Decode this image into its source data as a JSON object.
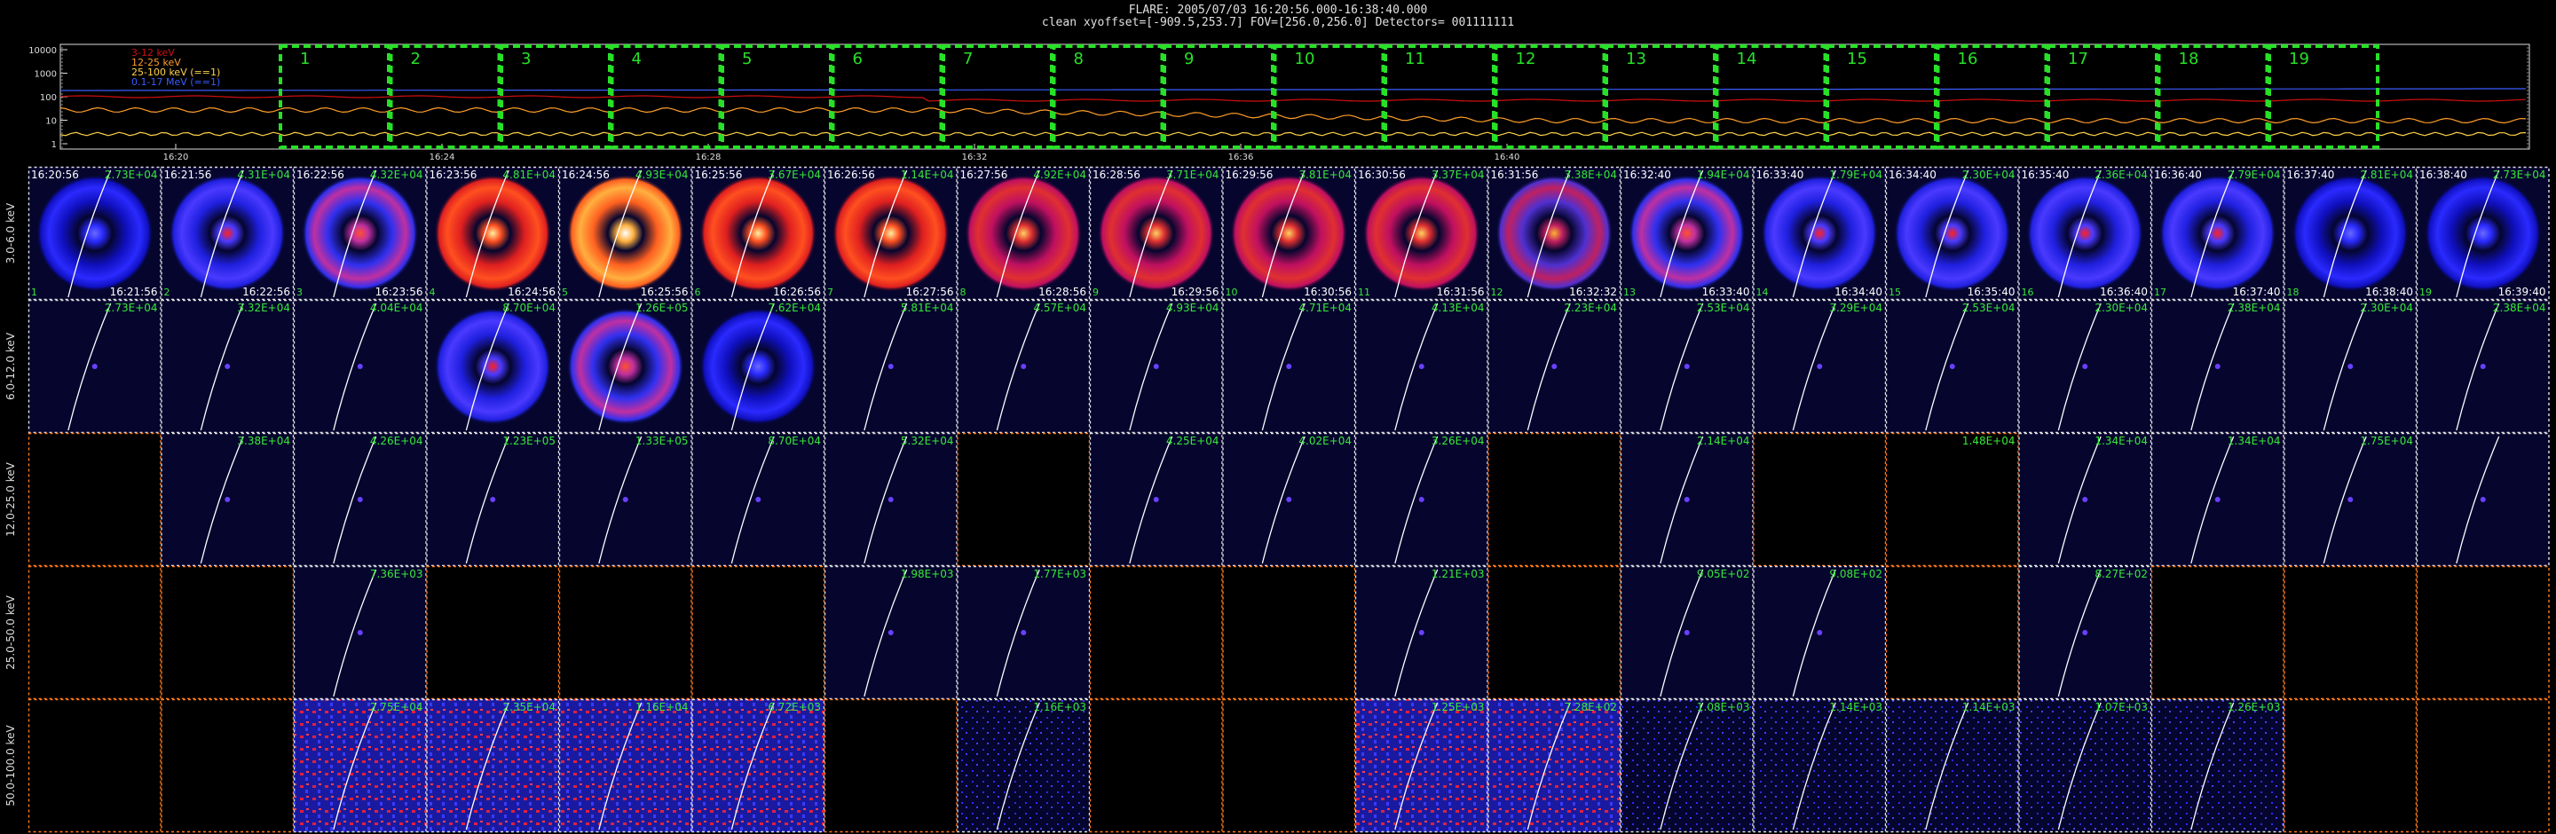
{
  "header": {
    "line1": "FLARE: 2005/07/03 16:20:56.000-16:38:40.000",
    "line2": "clean    xyoffset=[-909.5,253.7]   FOV=[256.0,256.0]    Detectors= 001111111"
  },
  "lightcurve": {
    "y_ticks": [
      "10000",
      "1000",
      "100",
      "10",
      "1"
    ],
    "x_ticks": [
      "16:20",
      "16:24",
      "16:28",
      "16:32",
      "16:36",
      "16:40"
    ],
    "legend": [
      {
        "label": "3-12 keV",
        "color": "#d01010"
      },
      {
        "label": "12-25 keV",
        "color": "#ff9d2a"
      },
      {
        "label": "25-100 keV (==1)",
        "color": "#ffd24a"
      },
      {
        "label": "0.1-17 MeV (==1)",
        "color": "#3c5cff"
      }
    ],
    "intervals": [
      "1",
      "2",
      "3",
      "4",
      "5",
      "6",
      "7",
      "8",
      "9",
      "10",
      "11",
      "12",
      "13",
      "14",
      "15",
      "16",
      "17",
      "18",
      "19"
    ]
  },
  "band_labels": [
    "3.0-6.0 keV",
    "6.0-12.0 keV",
    "12.0-25.0 keV",
    "25.0-50.0 keV",
    "50.0-100.0 keV"
  ],
  "start_times": [
    "16:20:56",
    "16:21:56",
    "16:22:56",
    "16:23:56",
    "16:24:56",
    "16:25:56",
    "16:26:56",
    "16:27:56",
    "16:28:56",
    "16:29:56",
    "16:30:56",
    "16:31:56",
    "16:32:40",
    "16:33:40",
    "16:34:40",
    "16:35:40",
    "16:36:40",
    "16:37:40",
    "16:38:40"
  ],
  "end_times": [
    "16:21:56",
    "16:22:56",
    "16:23:56",
    "16:24:56",
    "16:25:56",
    "16:26:56",
    "16:27:56",
    "16:28:56",
    "16:29:56",
    "16:30:56",
    "16:31:56",
    "16:32:32",
    "16:33:40",
    "16:34:40",
    "16:35:40",
    "16:36:40",
    "16:37:40",
    "16:38:40",
    "16:39:40"
  ],
  "rows": [
    {
      "style": "ring",
      "peaks": [
        "2.73E+04",
        "4.31E+04",
        "4.32E+04",
        "4.81E+04",
        "4.93E+04",
        "3.67E+04",
        "1.14E+04",
        "4.92E+04",
        "3.71E+04",
        "3.81E+04",
        "3.37E+04",
        "3.38E+04",
        "1.94E+04",
        "1.79E+04",
        "2.30E+04",
        "2.36E+04",
        "2.79E+04",
        "2.81E+04",
        "2.73E+04"
      ],
      "intensity": [
        "b1",
        "b2",
        "b3",
        "r3",
        "r4",
        "r3",
        "r3",
        "r2",
        "r2",
        "r2",
        "r2",
        "r1",
        "b3",
        "b2",
        "b2",
        "b2",
        "b2",
        "b1",
        "b1"
      ]
    },
    {
      "style": "faint",
      "peaks": [
        "2.73E+04",
        "3.32E+04",
        "4.04E+04",
        "8.70E+04",
        "1.26E+05",
        "7.62E+04",
        "5.81E+04",
        "4.57E+04",
        "4.93E+04",
        "4.71E+04",
        "4.13E+04",
        "2.23E+04",
        "2.53E+04",
        "3.29E+04",
        "2.53E+04",
        "2.30E+04",
        "2.38E+04",
        "2.30E+04",
        "2.38E+04"
      ],
      "intensity": [
        "e",
        "e",
        "e",
        "b2",
        "b3",
        "b1",
        "e",
        "e",
        "e",
        "e",
        "e",
        "e",
        "e",
        "e",
        "e",
        "e",
        "e",
        "e",
        "e"
      ]
    },
    {
      "style": "faint",
      "peaks": [
        "",
        "3.38E+04",
        "4.26E+04",
        "1.23E+05",
        "1.33E+05",
        "8.70E+04",
        "5.32E+04",
        "",
        "4.25E+04",
        "4.02E+04",
        "3.26E+04",
        "",
        "2.14E+04",
        "",
        "1.48E+04",
        "1.34E+04",
        "1.34E+04",
        "1.75E+04",
        ""
      ],
      "intensity": [
        "k",
        "e",
        "e",
        "e",
        "e",
        "e",
        "e",
        "k",
        "e",
        "e",
        "e",
        "k",
        "e",
        "k",
        "k",
        "e",
        "e",
        "e",
        "e"
      ]
    },
    {
      "style": "faint",
      "peaks": [
        "",
        "",
        "7.36E+03",
        "",
        "",
        "",
        "1.98E+03",
        "1.77E+03",
        "",
        "",
        "1.21E+03",
        "",
        "9.05E+02",
        "9.08E+02",
        "",
        "8.27E+02",
        "",
        "",
        ""
      ],
      "intensity": [
        "k",
        "k",
        "e",
        "k",
        "k",
        "k",
        "e",
        "e",
        "k",
        "k",
        "e",
        "k",
        "e",
        "e",
        "k",
        "e",
        "k",
        "k",
        "k"
      ]
    },
    {
      "style": "noise",
      "peaks": [
        "",
        "",
        "2.75E+04",
        "2.35E+04",
        "1.16E+04",
        "6.72E+03",
        "",
        "1.16E+03",
        "",
        "",
        "1.25E+03",
        "7.28E+02",
        "1.08E+03",
        "1.14E+03",
        "1.14E+03",
        "1.07E+03",
        "1.26E+03",
        "",
        ""
      ],
      "intensity": [
        "k",
        "k",
        "r3",
        "r3",
        "r2",
        "b3",
        "k",
        "e",
        "k",
        "k",
        "b1",
        "b1",
        "e",
        "e",
        "e",
        "e",
        "e",
        "k",
        "k"
      ]
    }
  ],
  "colors": {
    "panel_bg": "#05052e",
    "green_text": "#38e838",
    "interval_box": "#28e028",
    "orange_axis": "#ff7a1a",
    "limb": "#ffffff"
  }
}
